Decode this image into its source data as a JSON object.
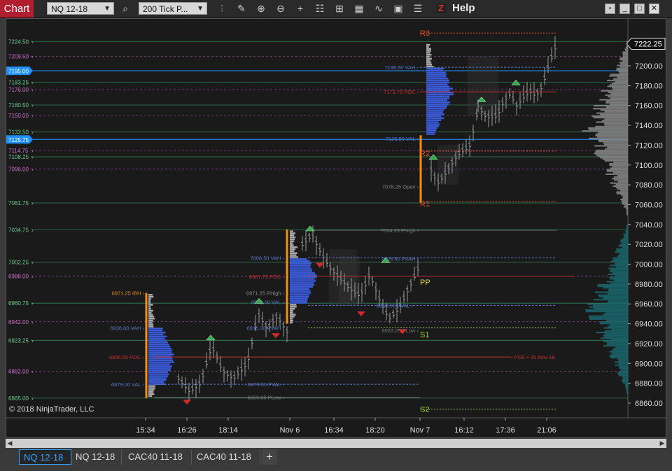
{
  "toolbar": {
    "title": "Chart",
    "instrument": "NQ 12-18",
    "interval": "200 Tick P...",
    "help": "Help",
    "help_z": "Z",
    "icons": [
      "search-icon",
      "bar-type-icon",
      "draw-icon",
      "zoom-in-icon",
      "zoom-out-icon",
      "crosshair-icon",
      "data-box-icon",
      "chart-trader-icon",
      "indicators-icon",
      "strategies-icon",
      "properties-icon",
      "templates-icon"
    ]
  },
  "window_buttons": {
    "restore": "▫",
    "minimize": "_",
    "maximize": "□",
    "close": "✕"
  },
  "chart": {
    "copyright": "© 2018 NinjaTrader, LLC",
    "current_price": "7222.25",
    "price_axis": {
      "min": 6850,
      "max": 7240,
      "ticks": [
        "7200.00",
        "7180.00",
        "7160.00",
        "7140.00",
        "7120.00",
        "7100.00",
        "7080.00",
        "7060.00",
        "7040.00",
        "7020.00",
        "7000.00",
        "6980.00",
        "6960.00",
        "6940.00",
        "6920.00",
        "6900.00",
        "6880.00",
        "6860.00"
      ],
      "tick_values": [
        7200,
        7180,
        7160,
        7140,
        7120,
        7100,
        7080,
        7060,
        7040,
        7020,
        7000,
        6980,
        6960,
        6940,
        6920,
        6900,
        6880,
        6860
      ]
    },
    "time_labels": [
      "15:34",
      "16:26",
      "18:14",
      "Nov 6",
      "16:34",
      "18:20",
      "Nov 7",
      "16:12",
      "17:36",
      "21:06"
    ],
    "left_levels": [
      {
        "label": "7224.50",
        "value": 7224.5,
        "color": "#6cd08f"
      },
      {
        "label": "7209.50",
        "value": 7209.5,
        "color": "#d070d0"
      },
      {
        "label": "7195.00",
        "value": 7195.0,
        "color": "#1e90ff",
        "highlight": true
      },
      {
        "label": "7183.25",
        "value": 7183.25,
        "color": "#6cd08f"
      },
      {
        "label": "7176.00",
        "value": 7176.0,
        "color": "#d070d0"
      },
      {
        "label": "7160.50",
        "value": 7160.5,
        "color": "#6cd08f"
      },
      {
        "label": "7150.00",
        "value": 7150.0,
        "color": "#d070d0"
      },
      {
        "label": "7133.50",
        "value": 7133.5,
        "color": "#6cd08f"
      },
      {
        "label": "7125.75",
        "value": 7125.75,
        "color": "#1e90ff",
        "highlight": true
      },
      {
        "label": "7114.75",
        "value": 7114.75,
        "color": "#d070d0"
      },
      {
        "label": "7108.25",
        "value": 7108.25,
        "color": "#6cd08f"
      },
      {
        "label": "7096.00",
        "value": 7096.0,
        "color": "#d070d0"
      },
      {
        "label": "7061.75",
        "value": 7061.75,
        "color": "#6cd08f"
      },
      {
        "label": "7034.75",
        "value": 7034.75,
        "color": "#6cd08f"
      },
      {
        "label": "7002.25",
        "value": 7002.25,
        "color": "#6cd08f"
      },
      {
        "label": "6988.00",
        "value": 6988.0,
        "color": "#d070d0"
      },
      {
        "label": "6960.75",
        "value": 6960.75,
        "color": "#6cd08f"
      },
      {
        "label": "6942.00",
        "value": 6942.0,
        "color": "#d070d0"
      },
      {
        "label": "6923.25",
        "value": 6923.25,
        "color": "#6cd08f"
      },
      {
        "label": "6892.00",
        "value": 6892.0,
        "color": "#d070d0"
      },
      {
        "label": "6865.00",
        "value": 6865.0,
        "color": "#6cd08f"
      }
    ],
    "annotations": [
      {
        "text": "R3",
        "value": 7233,
        "color": "#e0522a",
        "anchor": "pivot"
      },
      {
        "text": "7198.50 VAH ›",
        "value": 7198.5,
        "color": "#5a7ac8"
      },
      {
        "text": "7173.75 POC ›",
        "value": 7173.75,
        "color": "#c83030"
      },
      {
        "text": "7126.50 VAL ›",
        "value": 7126.5,
        "color": "#5a7ac8"
      },
      {
        "text": "7078.25 Open ›",
        "value": 7078.25,
        "color": "#888888"
      },
      {
        "text": "R2",
        "value": 7112,
        "color": "#e0522a",
        "anchor": "pivot"
      },
      {
        "text": "R1",
        "value": 7061,
        "color": "#e0522a",
        "anchor": "pivot"
      },
      {
        "text": "7034.25 PHigh ›",
        "value": 7034.25,
        "color": "#777777"
      },
      {
        "text": "7006.50 VAH ›",
        "value": 7006.5,
        "color": "#5a7ac8"
      },
      {
        "text": "6987.75 POC ›",
        "value": 6987.75,
        "color": "#c83030"
      },
      {
        "text": "6971.25 PHigh ›",
        "value": 6971.25,
        "color": "#888888"
      },
      {
        "text": "6962.00 VAL ›",
        "value": 6962.0,
        "color": "#5a7ac8"
      },
      {
        "text": "6971.25 IBH ›",
        "value": 6971.25,
        "color": "#e08a20"
      },
      {
        "text": "6936.00 VAH ›",
        "value": 6936.0,
        "color": "#5a7ac8"
      },
      {
        "text": "6906.50 POC ›",
        "value": 6906.5,
        "color": "#c83030"
      },
      {
        "text": "6879.00 VAL ›",
        "value": 6879.0,
        "color": "#5a7ac8"
      },
      {
        "text": "6879.00 PVAL ›",
        "value": 6879.0,
        "color": "#5a7ac8"
      },
      {
        "text": "6866.00 PLow ›",
        "value": 6866.0,
        "color": "#777777"
      },
      {
        "text": "6936.00 PVAH ›",
        "value": 6936.0,
        "color": "#5a7ac8"
      },
      {
        "text": "7005.50 PVAH ›",
        "value": 7005.5,
        "color": "#5a7ac8"
      },
      {
        "text": "6958.50 PVAL ›",
        "value": 6958.5,
        "color": "#5a7ac8"
      },
      {
        "text": "6933.25 PLow ›",
        "value": 6933.25,
        "color": "#777777"
      },
      {
        "text": "‹ POC • 05-Nov-18",
        "value": 6906.5,
        "color": "#c83030"
      },
      {
        "text": "PP",
        "value": 6982,
        "color": "#e8d060",
        "anchor": "pivot"
      },
      {
        "text": "S1",
        "value": 6929,
        "color": "#9ad030",
        "anchor": "pivot"
      },
      {
        "text": "S2",
        "value": 6854,
        "color": "#9ad030",
        "anchor": "pivot"
      }
    ],
    "colors": {
      "background": "#1a1a1a",
      "green_level": "#3fae70",
      "pink_level": "#b05ab0",
      "blue_level": "#1e90ff",
      "profile_blue": "#3a5ad8",
      "profile_gray": "#aaaaaa",
      "volume_teal": "#1a6a70"
    }
  },
  "tabs": [
    {
      "label": "NQ 12-18",
      "active": true
    },
    {
      "label": "NQ 12-18",
      "active": false
    },
    {
      "label": "CAC40 11-18",
      "active": false
    },
    {
      "label": "CAC40 11-18",
      "active": false
    }
  ],
  "tab_add": "+"
}
